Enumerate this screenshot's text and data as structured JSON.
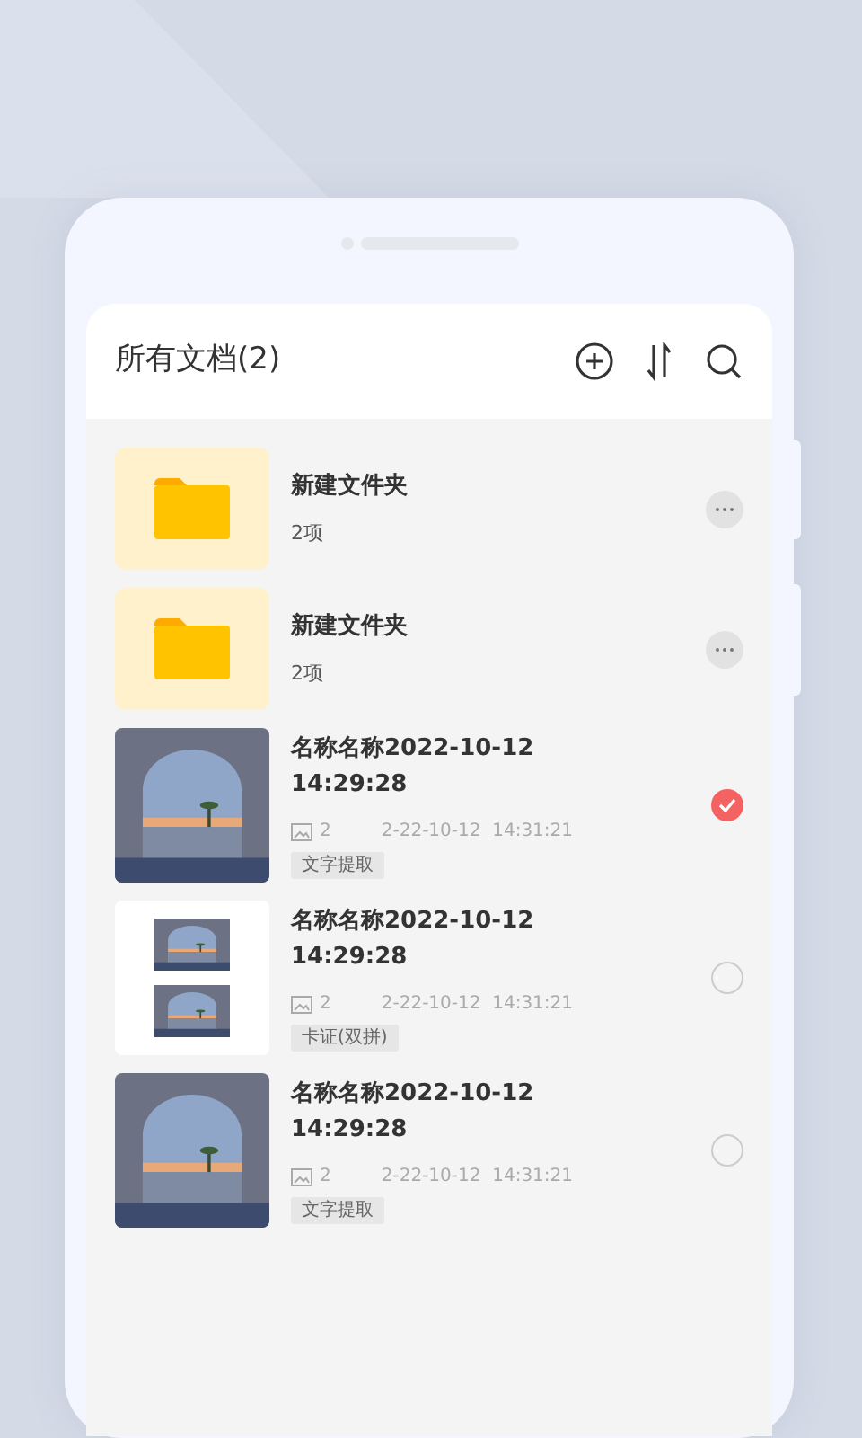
{
  "screen": {
    "title": "所有文档(2)"
  },
  "items": [
    {
      "kind": "folder",
      "name": "新建文件夹",
      "count": "2项"
    },
    {
      "kind": "folder",
      "name": "新建文件夹",
      "count": "2项"
    },
    {
      "kind": "document",
      "name": "名称名称2022-10-12 14:29:28",
      "pages": "2",
      "date": "2-22-10-12  14:31:21",
      "tag": "文字提取",
      "selected": true
    },
    {
      "kind": "document",
      "name": "名称名称2022-10-12 14:29:28",
      "pages": "2",
      "date": "2-22-10-12  14:31:21",
      "tag": "卡证(双拼)",
      "selected": false
    },
    {
      "kind": "document",
      "name": "名称名称2022-10-12 14:29:28",
      "pages": "2",
      "date": "2-22-10-12  14:31:21",
      "tag": "文字提取",
      "selected": false
    }
  ]
}
